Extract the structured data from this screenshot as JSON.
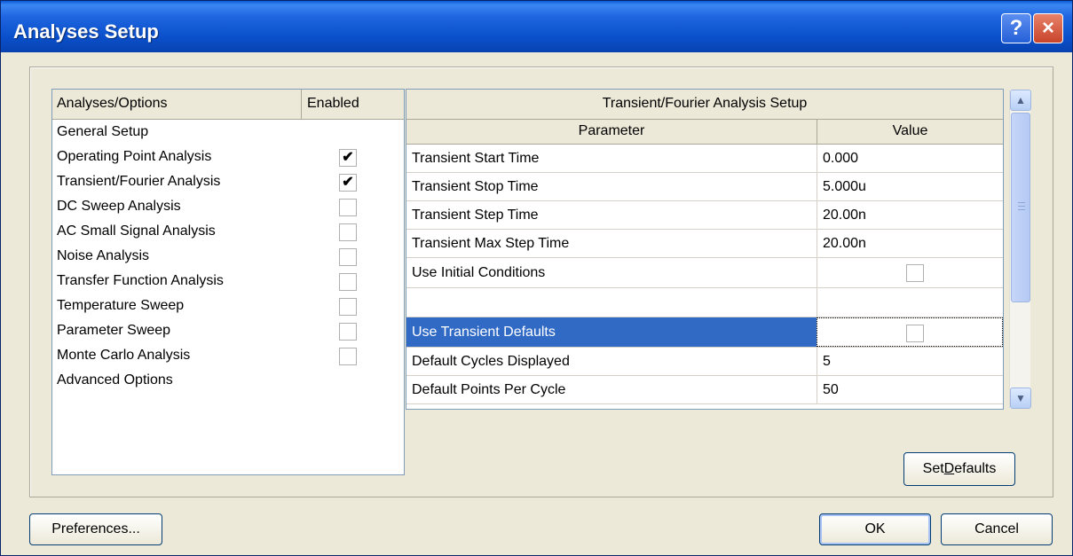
{
  "window": {
    "title": "Analyses Setup",
    "help_label": "?",
    "close_label": "×"
  },
  "left": {
    "header_name": "Analyses/Options",
    "header_enabled": "Enabled",
    "items": [
      {
        "label": "General Setup",
        "has_checkbox": false,
        "checked": false
      },
      {
        "label": "Operating Point Analysis",
        "has_checkbox": true,
        "checked": true
      },
      {
        "label": "Transient/Fourier Analysis",
        "has_checkbox": true,
        "checked": true
      },
      {
        "label": "DC Sweep Analysis",
        "has_checkbox": true,
        "checked": false
      },
      {
        "label": "AC Small Signal Analysis",
        "has_checkbox": true,
        "checked": false
      },
      {
        "label": "Noise Analysis",
        "has_checkbox": true,
        "checked": false
      },
      {
        "label": "Transfer Function Analysis",
        "has_checkbox": true,
        "checked": false
      },
      {
        "label": "Temperature Sweep",
        "has_checkbox": true,
        "checked": false
      },
      {
        "label": "Parameter Sweep",
        "has_checkbox": true,
        "checked": false
      },
      {
        "label": "Monte Carlo Analysis",
        "has_checkbox": true,
        "checked": false
      },
      {
        "label": "Advanced Options",
        "has_checkbox": false,
        "checked": false
      }
    ],
    "check_glyph": "✔"
  },
  "grid": {
    "title": "Transient/Fourier Analysis Setup",
    "col_parameter": "Parameter",
    "col_value": "Value",
    "rows": [
      {
        "param": "Transient Start Time",
        "value": "0.000",
        "checkbox": false
      },
      {
        "param": "Transient Stop Time",
        "value": "5.000u",
        "checkbox": false
      },
      {
        "param": "Transient Step Time",
        "value": "20.00n",
        "checkbox": false
      },
      {
        "param": "Transient Max Step Time",
        "value": "20.00n",
        "checkbox": false
      },
      {
        "param": "Use Initial Conditions",
        "value": "",
        "checkbox": true
      },
      {
        "param": "",
        "value": "",
        "checkbox": false
      },
      {
        "param": "Use Transient Defaults",
        "value": "",
        "checkbox": true,
        "selected": true
      },
      {
        "param": "Default Cycles Displayed",
        "value": "5",
        "checkbox": false
      },
      {
        "param": "Default Points Per Cycle",
        "value": "50",
        "checkbox": false
      }
    ]
  },
  "buttons": {
    "set_defaults_pre": "Set ",
    "set_defaults_ul": "D",
    "set_defaults_post": "efaults",
    "preferences": "Preferences...",
    "ok": "OK",
    "cancel": "Cancel"
  },
  "icons": {
    "scroll_up": "up-arrow-icon",
    "scroll_down": "down-arrow-icon"
  }
}
